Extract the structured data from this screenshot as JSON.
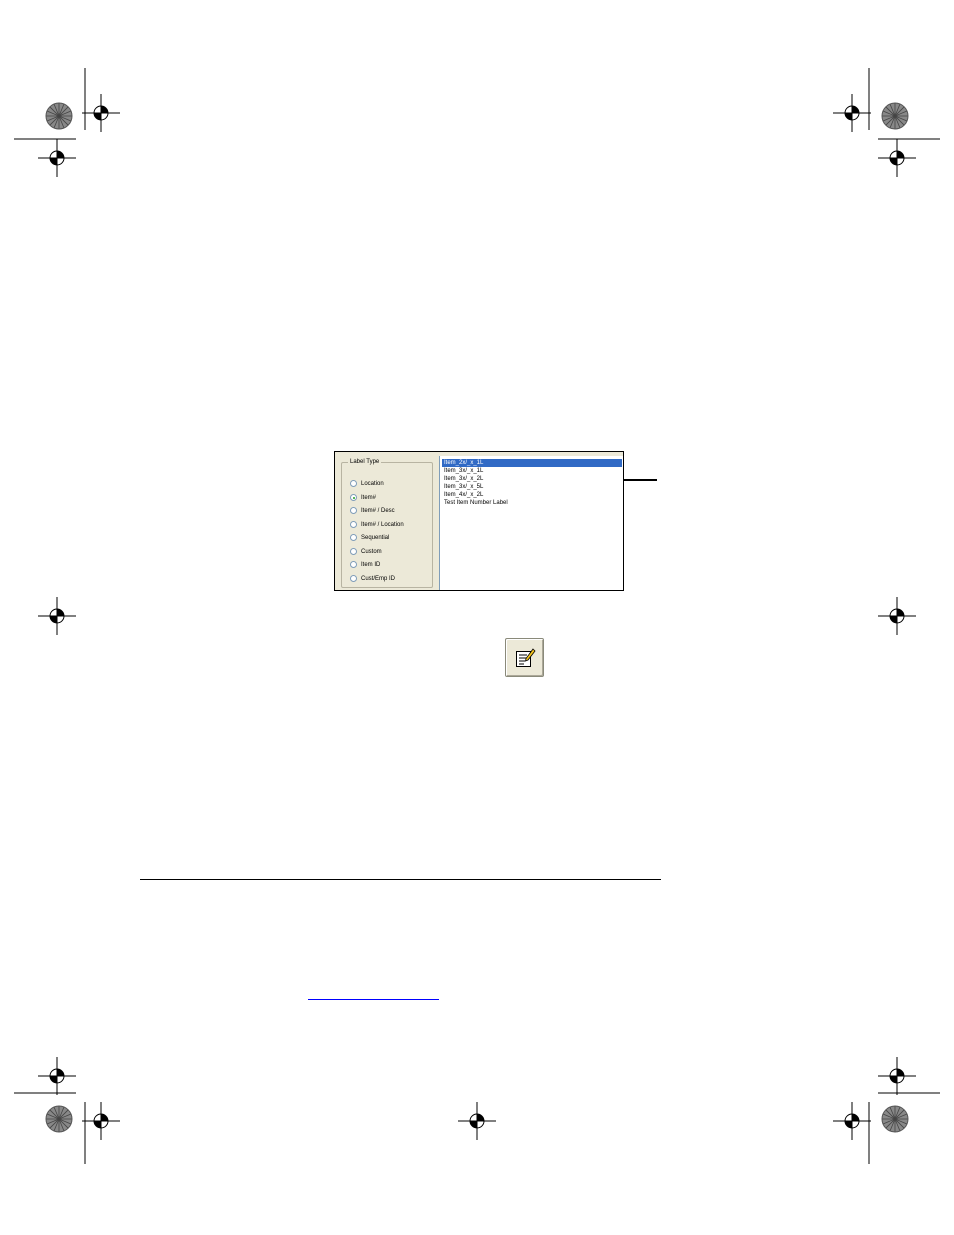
{
  "dialog": {
    "group_title": "Label Type",
    "radio_options": [
      {
        "label": "Location",
        "checked": false
      },
      {
        "label": "Item#",
        "checked": true
      },
      {
        "label": "Item# / Desc",
        "checked": false
      },
      {
        "label": "Item# / Location",
        "checked": false
      },
      {
        "label": "Sequential",
        "checked": false
      },
      {
        "label": "Custom",
        "checked": false
      },
      {
        "label": "Item ID",
        "checked": false
      },
      {
        "label": "Cust/Emp ID",
        "checked": false
      }
    ],
    "list_items": [
      {
        "label": "Item_2x/_x_1L",
        "selected": true
      },
      {
        "label": "Item_3x/_x_1L",
        "selected": false
      },
      {
        "label": "Item_3x/_x_2L",
        "selected": false
      },
      {
        "label": "Item_3x/_x_5L",
        "selected": false
      },
      {
        "label": "Item_4x/_x_2L",
        "selected": false
      },
      {
        "label": "Test Item Number Label",
        "selected": false
      }
    ]
  },
  "colors": {
    "selection": "#316ac5",
    "dialog_face": "#ece9d8"
  },
  "icons": {
    "edit_button": "edit-label-icon",
    "registration_marks": "crosshair-registration-icon",
    "color_targets": "starburst-target-icon"
  }
}
